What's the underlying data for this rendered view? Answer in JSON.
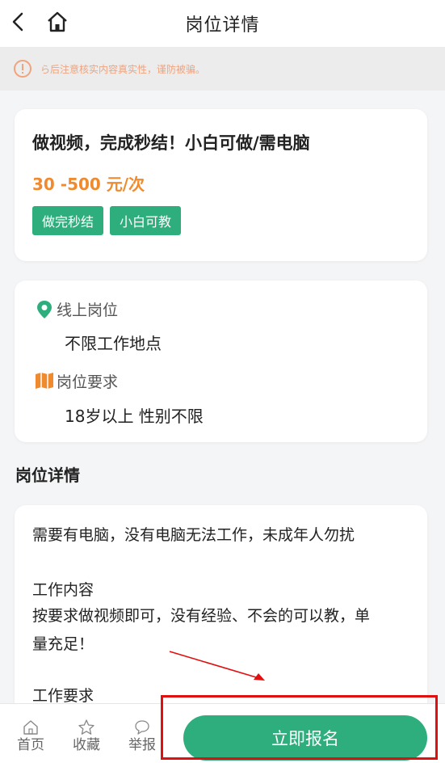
{
  "header": {
    "title": "岗位详情",
    "back_icon": "chevron-left-icon",
    "home_icon": "home-icon"
  },
  "notice": {
    "text": "ら后注意核实内容真实性，谨防被骗。",
    "icon": "info-circle-icon",
    "color": "#f0a37d"
  },
  "job": {
    "title": "做视频，完成秒结！小白可做/需电脑",
    "salary": "30 -500 元/次",
    "tags": [
      "做完秒结",
      "小白可教"
    ]
  },
  "info": {
    "location_label": "线上岗位",
    "location_value": "不限工作地点",
    "requirement_label": "岗位要求",
    "requirement_value": "18岁以上 性别不限"
  },
  "details": {
    "section_title": "岗位详情",
    "lines": [
      "需要有电脑，没有电脑无法工作，未成年人勿扰",
      "",
      "工作内容",
      "按要求做视频即可，没有经验、不会的可以教，单",
      "量充足！",
      "",
      "工作要求"
    ]
  },
  "bottom_nav": {
    "items": [
      {
        "label": "首页",
        "icon": "home-icon"
      },
      {
        "label": "收藏",
        "icon": "star-icon"
      },
      {
        "label": "举报",
        "icon": "chat-bubble-icon"
      }
    ],
    "apply_label": "立即报名"
  },
  "colors": {
    "accent": "#2fae7d",
    "salary": "#f08a2e",
    "annotation": "#e01010"
  }
}
